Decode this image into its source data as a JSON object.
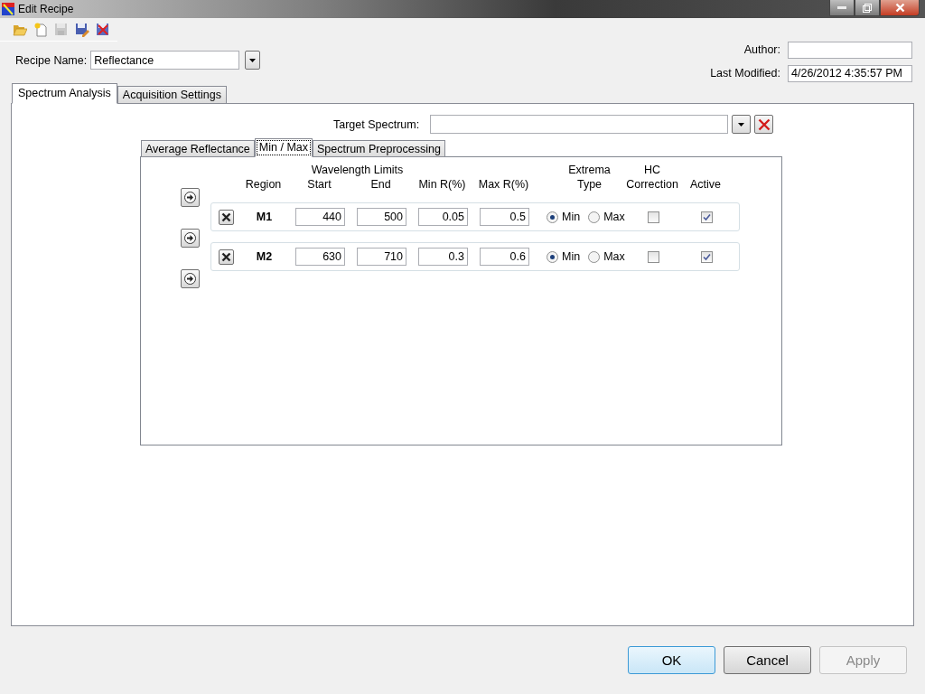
{
  "window": {
    "title": "Edit Recipe"
  },
  "toolbar": [
    {
      "kind": "open",
      "disabled": false
    },
    {
      "kind": "new",
      "disabled": false
    },
    {
      "kind": "save",
      "disabled": true
    },
    {
      "kind": "save-as",
      "disabled": false
    },
    {
      "kind": "delete",
      "disabled": false
    }
  ],
  "recipe_name": {
    "label": "Recipe Name:",
    "value": "Reflectance"
  },
  "author": {
    "label": "Author:"
  },
  "last_modified": {
    "label": "Last Modified:",
    "value": "4/26/2012 4:35:57 PM"
  },
  "tabs": [
    {
      "label": "Spectrum Analysis",
      "selected": true
    },
    {
      "label": "Acquisition Settings",
      "selected": false
    }
  ],
  "target_spectrum": {
    "label": "Target Spectrum:"
  },
  "subtabs": [
    {
      "label": "Average Reflectance",
      "selected": false
    },
    {
      "label": "Min / Max",
      "selected": true
    },
    {
      "label": "Spectrum Preprocessing",
      "selected": false
    }
  ],
  "header_group": "Wavelength Limits",
  "columns": [
    {
      "lines": [
        "Region"
      ]
    },
    {
      "lines": [
        "Start"
      ]
    },
    {
      "lines": [
        "End"
      ]
    },
    {
      "lines": [
        "Min R(%)"
      ]
    },
    {
      "lines": [
        "Max R(%)"
      ]
    },
    {
      "lines": [
        "Extrema",
        "Type"
      ]
    },
    {
      "lines": [
        "HC",
        "Correction"
      ]
    },
    {
      "lines": [
        "Active"
      ]
    }
  ],
  "rows": [
    {
      "region": "M1",
      "start": "440",
      "end": "500",
      "min_r": "0.05",
      "max_r": "0.5",
      "extrema": [
        {
          "label": "Min",
          "selected": true
        },
        {
          "label": "Max",
          "selected": false
        }
      ],
      "hc_correction": false,
      "active": true
    },
    {
      "region": "M2",
      "start": "630",
      "end": "710",
      "min_r": "0.3",
      "max_r": "0.6",
      "extrema": [
        {
          "label": "Min",
          "selected": true
        },
        {
          "label": "Max",
          "selected": false
        }
      ],
      "hc_correction": false,
      "active": true
    }
  ],
  "buttons": [
    {
      "label": "OK",
      "default": true,
      "disabled": false
    },
    {
      "label": "Cancel",
      "default": false,
      "disabled": false
    },
    {
      "label": "Apply",
      "default": false,
      "disabled": true
    }
  ]
}
